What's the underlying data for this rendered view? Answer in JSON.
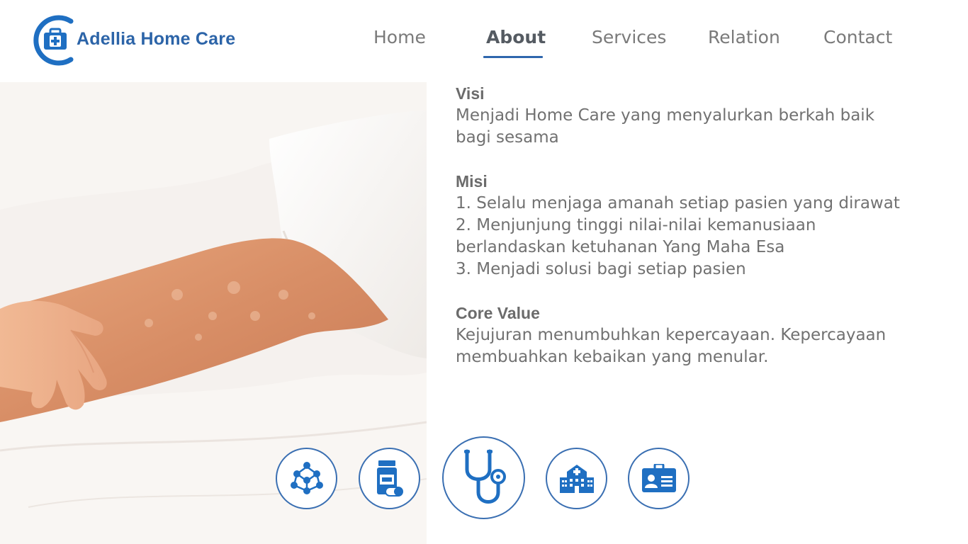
{
  "brand": {
    "name": "Adellia Home Care",
    "logo_icon": "medical-briefcase-icon",
    "color": "#2c64a8"
  },
  "nav": {
    "items": [
      {
        "label": "Home"
      },
      {
        "label": "About"
      },
      {
        "label": "Services"
      },
      {
        "label": "Relation"
      },
      {
        "label": "Contact"
      }
    ],
    "active": "About",
    "active_color": "#2f67ad"
  },
  "photo": {
    "subject": "hands-holding-elderly-arm-photo"
  },
  "about": {
    "visi_title": "Visi",
    "visi_text_1": "Menjadi Home Care yang menyalurkan berkah baik",
    "visi_text_2": "bagi sesama",
    "misi_title": "Misi",
    "misi_1": "1. Selalu menjaga amanah setiap pasien yang dirawat",
    "misi_2a": "2. Menjunjung tinggi nilai-nilai kemanusiaan",
    "misi_2b": "berlandaskan ketuhanan Yang Maha Esa",
    "misi_3": "3. Menjadi solusi bagi setiap pasien",
    "core_title": "Core Value",
    "core_1": "Kejujuran menumbuhkan kepercayaan. Kepercayaan",
    "core_2": "membuahkan kebaikan yang menular."
  },
  "service_icons": [
    "network-people-icon",
    "medicine-bottle-icon",
    "stethoscope-icon",
    "hospital-icon",
    "id-card-icon"
  ],
  "colors": {
    "accent": "#1f6fc2",
    "text": "#717171"
  }
}
